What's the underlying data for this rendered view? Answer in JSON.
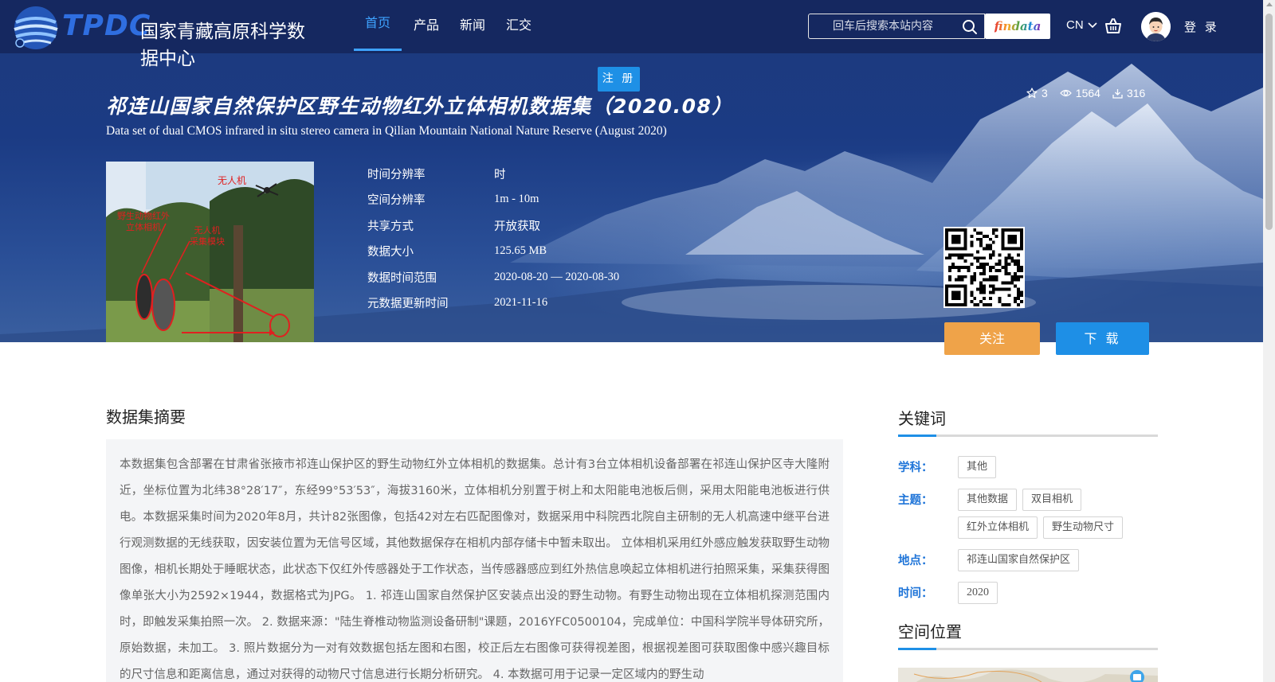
{
  "header": {
    "logo_text": "TPDC",
    "site_name": "国家青藏高原科学数据中心",
    "nav": [
      "首页",
      "产品",
      "新闻",
      "汇交"
    ],
    "search_placeholder": "回车后搜索本站内容",
    "findata_label": "findata",
    "lang_label": "CN",
    "login_label": "登 录",
    "icons": [
      "search-icon",
      "chevron-down-icon",
      "basket-icon",
      "avatar"
    ]
  },
  "register_label": "注 册",
  "dataset": {
    "title_cn": "祁连山国家自然保护区野生动物红外立体相机数据集（2020.08）",
    "title_en": "Data set of dual CMOS infrared in situ stereo camera in Qilian Mountain National Nature Reserve (August 2020)",
    "stats": {
      "stars": "3",
      "views": "1564",
      "downloads": "316"
    },
    "thumbnail_labels": [
      "无人机",
      "野生动物红外\n立体相机",
      "无人机\n采集模块"
    ],
    "meta": [
      {
        "key": "时间分辨率",
        "value": "时"
      },
      {
        "key": "空间分辨率",
        "value": "1m - 10m"
      },
      {
        "key": "共享方式",
        "value": "开放获取"
      },
      {
        "key": "数据大小",
        "value": "125.65 MB"
      },
      {
        "key": "数据时间范围",
        "value": "2020-08-20 — 2020-08-30"
      },
      {
        "key": "元数据更新时间",
        "value": "2021-11-16"
      }
    ],
    "follow_label": "关注",
    "download_label": "下 载"
  },
  "abstract": {
    "title": "数据集摘要",
    "text": "本数据集包含部署在甘肃省张掖市祁连山保护区的野生动物红外立体相机的数据集。总计有3台立体相机设备部署在祁连山保护区寺大隆附近，坐标位置为北纬38°28′17″，东经99°53′53″，海拔3160米，立体相机分别置于树上和太阳能电池板后侧，采用太阳能电池板进行供电。本数据采集时间为2020年8月，共计82张图像，包括42对左右匹配图像对，数据采用中科院西北院自主研制的无人机高速中继平台进行观测数据的无线获取，因安装位置为无信号区域，其他数据保存在相机内部存储卡中暂未取出。 立体相机采用红外感应触发获取野生动物图像，相机长期处于睡眠状态，此状态下仅红外传感器处于工作状态，当传感器感应到红外热信息唤起立体相机进行拍照采集，采集获得图像单张大小为2592×1944，数据格式为JPG。 1. 祁连山国家自然保护区安装点出没的野生动物。有野生动物出现在立体相机探测范围内时，即触发采集拍照一次。 2. 数据来源：\"陆生脊椎动物监测设备研制\"课题，2016YFC0500104，完成单位：中国科学院半导体研究所，原始数据，未加工。 3. 照片数据分为一对有效数据包括左图和右图，校正后左右图像可获得视差图，根据视差图可获取图像中感兴趣目标的尺寸信息和距离信息，通过对获得的动物尺寸信息进行长期分析研究。 4. 本数据可用于记录一定区域内的野生动"
  },
  "keywords": {
    "title": "关键词",
    "rows": [
      {
        "label": "学科：",
        "tags": [
          "其他"
        ]
      },
      {
        "label": "主题：",
        "tags": [
          "其他数据",
          "双目相机",
          "红外立体相机",
          "野生动物尺寸"
        ]
      },
      {
        "label": "地点：",
        "tags": [
          "祁连山国家自然保护区"
        ]
      },
      {
        "label": "时间：",
        "tags": [
          "2020"
        ]
      }
    ]
  },
  "spatial": {
    "title": "空间位置"
  },
  "colors": {
    "header_bg": "#14265c",
    "accent_blue": "#1e8fe6",
    "nav_active": "#3ea3ff",
    "follow_orange": "#efa349",
    "keyword_label": "#1e74d8"
  }
}
